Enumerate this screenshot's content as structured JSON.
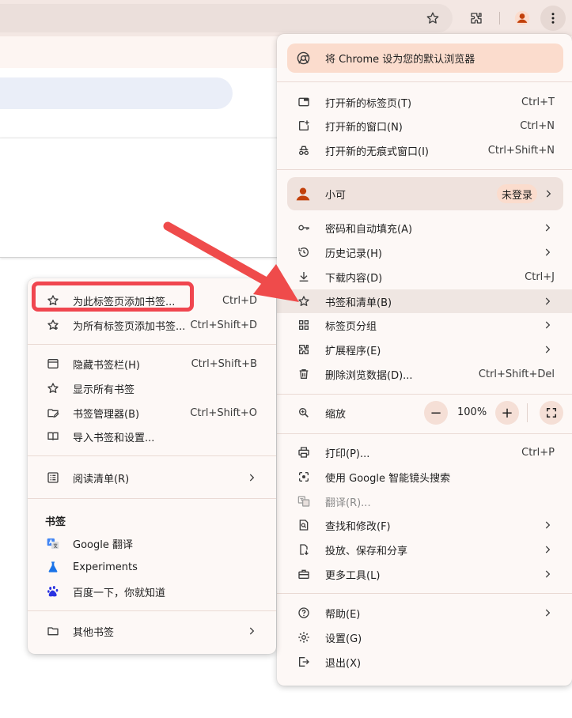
{
  "toolbar": {
    "icons": [
      "star-icon",
      "extensions-icon",
      "profile-icon",
      "more-vert-icon"
    ]
  },
  "colors": {
    "accent": "#c2410c",
    "arrow": "#ef4b4b",
    "highlight_ring": "#f0464f",
    "menu_bg": "#fdf8f6"
  },
  "main_menu": {
    "default_browser_banner": "将 Chrome 设为您的默认浏览器",
    "new_tab": {
      "label": "打开新的标签页(T)",
      "shortcut": "Ctrl+T"
    },
    "new_window": {
      "label": "打开新的窗口(N)",
      "shortcut": "Ctrl+N"
    },
    "incognito": {
      "label": "打开新的无痕式窗口(I)",
      "shortcut": "Ctrl+Shift+N"
    },
    "profile": {
      "name": "小可",
      "status": "未登录"
    },
    "passwords": {
      "label": "密码和自动填充(A)"
    },
    "history": {
      "label": "历史记录(H)"
    },
    "downloads": {
      "label": "下载内容(D)",
      "shortcut": "Ctrl+J"
    },
    "bookmarks": {
      "label": "书签和清单(B)"
    },
    "tab_groups": {
      "label": "标签页分组"
    },
    "extensions": {
      "label": "扩展程序(E)"
    },
    "clear_data": {
      "label": "删除浏览数据(D)...",
      "shortcut": "Ctrl+Shift+Del"
    },
    "zoom": {
      "label": "缩放",
      "minus": "−",
      "value": "100%",
      "plus": "+"
    },
    "print": {
      "label": "打印(P)...",
      "shortcut": "Ctrl+P"
    },
    "lens": {
      "label": "使用 Google 智能镜头搜索"
    },
    "translate": {
      "label": "翻译(R)..."
    },
    "find": {
      "label": "查找和修改(F)"
    },
    "cast": {
      "label": "投放、保存和分享"
    },
    "more_tools": {
      "label": "更多工具(L)"
    },
    "help": {
      "label": "帮助(E)"
    },
    "settings": {
      "label": "设置(G)"
    },
    "exit": {
      "label": "退出(X)"
    }
  },
  "bookmarks_menu": {
    "add_this": {
      "label": "为此标签页添加书签...",
      "shortcut": "Ctrl+D"
    },
    "add_all": {
      "label": "为所有标签页添加书签...",
      "shortcut": "Ctrl+Shift+D"
    },
    "hide_bar": {
      "label": "隐藏书签栏(H)",
      "shortcut": "Ctrl+Shift+B"
    },
    "show_all": {
      "label": "显示所有书签"
    },
    "manager": {
      "label": "书签管理器(B)",
      "shortcut": "Ctrl+Shift+O"
    },
    "import": {
      "label": "导入书签和设置..."
    },
    "reading_list": {
      "label": "阅读清单(R)"
    },
    "section_title": "书签",
    "items": [
      {
        "label": "Google 翻译",
        "icon": "google-translate-icon"
      },
      {
        "label": "Experiments",
        "icon": "flask-icon"
      },
      {
        "label": "百度一下，你就知道",
        "icon": "baidu-paw-icon"
      }
    ],
    "other": {
      "label": "其他书签"
    }
  }
}
